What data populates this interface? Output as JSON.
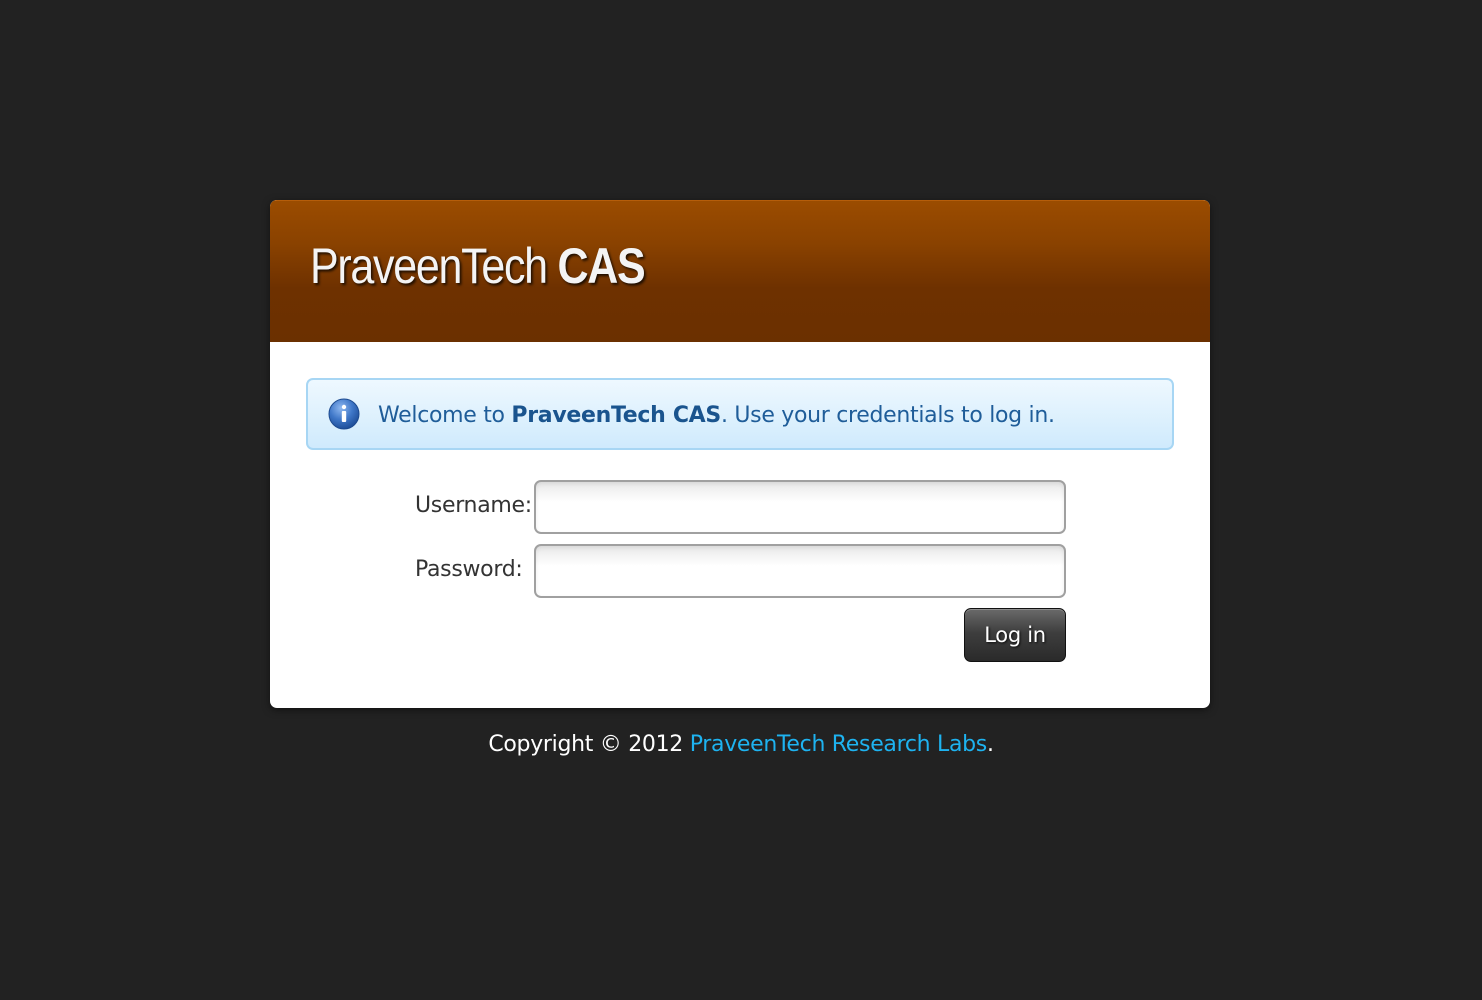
{
  "header": {
    "brand_regular": "PraveenTech",
    "brand_bold": "CAS"
  },
  "info": {
    "icon": "info-icon",
    "prefix": "Welcome to ",
    "highlight": "PraveenTech CAS",
    "suffix": ". Use your credentials to log in."
  },
  "form": {
    "username_label": "Username:",
    "username_value": "",
    "password_label": "Password:",
    "password_value": "",
    "submit_label": "Log in"
  },
  "footer": {
    "copyright": "Copyright © 2012 ",
    "link_text": "PraveenTech Research Labs",
    "end": "."
  },
  "colors": {
    "background": "#222222",
    "header_top": "#9b4c00",
    "header_bottom": "#6b3000",
    "info_background": "#dcf0fd",
    "info_border": "#a7d6f4",
    "info_text": "#1f5d99",
    "link": "#1eb3f0",
    "button": "#3e3e3e"
  }
}
